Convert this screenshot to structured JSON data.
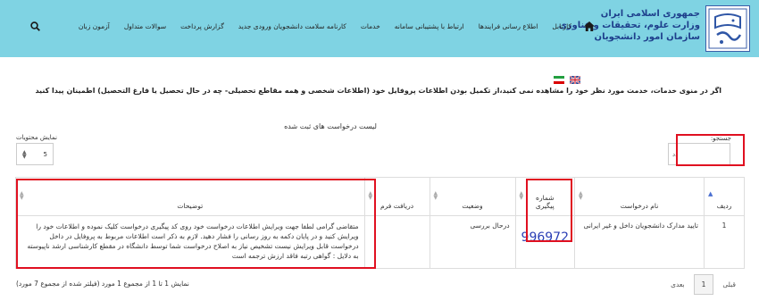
{
  "header": {
    "org_lines": [
      "جمهوری اسلامی ایران",
      "وزارت علوم، تحقیقات و فناوری",
      "سازمان امور دانشجویان"
    ],
    "nav": [
      {
        "label": "کارتابل"
      },
      {
        "label": "اطلاع رسانی فرایندها"
      },
      {
        "label": "ارتباط با پشتیبانی سامانه"
      },
      {
        "label": "خدمات"
      },
      {
        "label": "کارنامه سلامت دانشجویان ورودی جدید"
      },
      {
        "label": "گزارش پرداخت"
      },
      {
        "label": "سوالات متداول"
      },
      {
        "label": "آزمون زبان"
      }
    ]
  },
  "notice": "اگر در منوی خدمات، خدمت مورد نظر خود را مشاهده نمی کنید،از تکمیل بودن اطلاعات پروفایل خود (اطلاعات شخصی و همه مقاطع تحصیلی- چه در حال تحصیل یا فارغ التحصیل) اطمینان پیدا کنید",
  "list_title": "لیست درخواست های ثبت شده",
  "search": {
    "label": "جستجو:",
    "value": "دد"
  },
  "page_length": {
    "label": "نمایش محتویات",
    "value": "5"
  },
  "table": {
    "headers": {
      "row": "ردیف",
      "name": "نام درخواست",
      "tracking_line1": "شماره",
      "tracking_line2": "پیگیری",
      "status": "وضعیت",
      "form": "دریافت فرم",
      "desc": "توضیحات"
    },
    "rows": [
      {
        "row": "1",
        "name": "تایید مدارک دانشجویان داخل و غیر ایرانی",
        "tracking": "996972",
        "status": "درحال بررسی",
        "form": "",
        "desc": "متقاضی گرامی لطفا جهت ویرایش اطلاعات درخواست خود روی کد پیگیری درخواست کلیک نموده و اطلاعات خود را ویرایش کنید و در پایان دکمه به روز رسانی را فشار دهید. لازم به ذکر است اطلاعات مربوط به پروفایل در داخل درخواست قابل ویرایش نیست تشخیص نیاز به اصلاح درخواست شما توسط دانشگاه در مقطع کارشناسی ارشد ناپیوسته به دلایل : گواهی رتبه فاقد ارزش ترجمه است"
      }
    ]
  },
  "info": "نمایش 1 تا 1 از مجموع 1 مورد (فیلتر شده از مجموع 7 مورد)",
  "pager": {
    "prev": "قبلی",
    "current": "1",
    "next": "بعدی"
  },
  "colors": {
    "header_bg": "#7fd3e3",
    "highlight": "#e01020",
    "link": "#2b3fb5"
  }
}
